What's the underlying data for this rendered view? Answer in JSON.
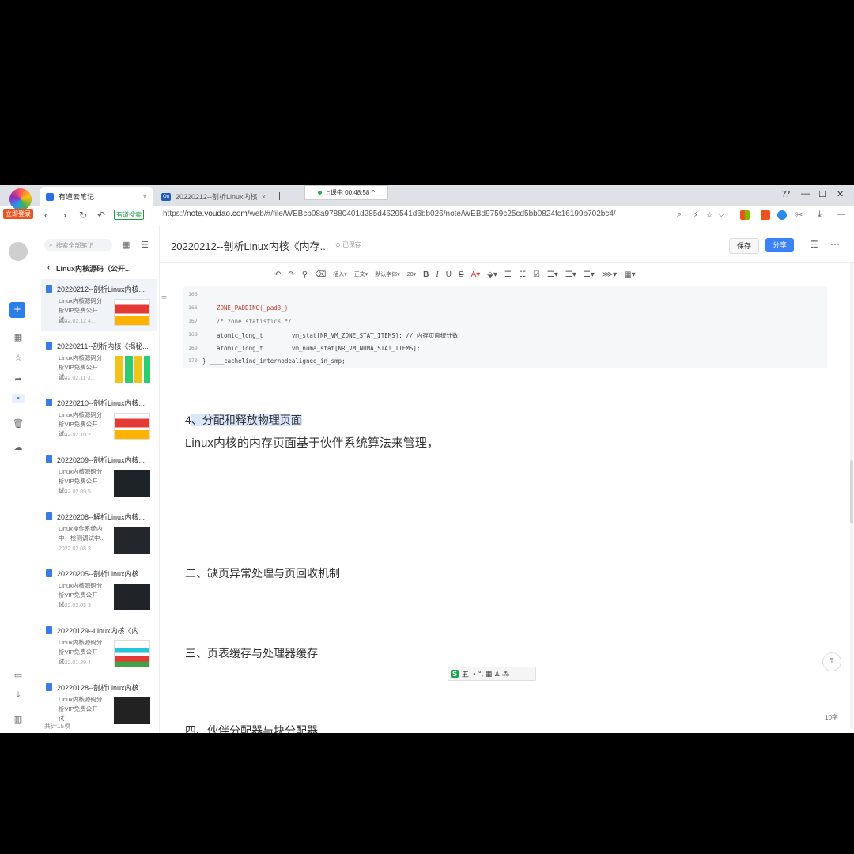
{
  "browser": {
    "logo_label": "立即登录",
    "tabs": [
      {
        "title": "有道云笔记",
        "active": true
      },
      {
        "title": "20220212--剖析Linux内核《",
        "active": false
      }
    ],
    "recording": "上课中 00:48:58",
    "window_controls": [
      "⁇",
      "—",
      "☐",
      "✕"
    ],
    "nav": {
      "back": "‹",
      "forward": "›",
      "reload": "↻",
      "home": "↶"
    },
    "secure_badge": "有道搜索",
    "url_scheme": "https://",
    "url_host": "note.youdao.com",
    "url_path": "/web/#/file/WEBcb08a97880401d285d4629541d6bb026/note/WEBd9759c25cd5bb0824fc16199b702bc4/"
  },
  "rail": {
    "new_button": "+",
    "items": [
      {
        "name": "recent",
        "glyph": "▦"
      },
      {
        "name": "star",
        "glyph": "☆"
      },
      {
        "name": "share",
        "glyph": "➦"
      },
      {
        "name": "folder",
        "glyph": "▪"
      },
      {
        "name": "trash",
        "glyph": "🗑"
      },
      {
        "name": "cloud",
        "glyph": "☁"
      },
      {
        "name": "device",
        "glyph": "▭"
      },
      {
        "name": "download",
        "glyph": "⤓"
      },
      {
        "name": "panel",
        "glyph": "▥"
      }
    ]
  },
  "panel": {
    "search_placeholder": "搜索全部笔记",
    "folder_back": "‹",
    "folder_name": "Linux内核源码（公开...",
    "notes": [
      {
        "title": "20220212--剖析Linux内核...",
        "summary": "Linux内核源码分\n析VIP免费公开试...",
        "date": "2022.02.12",
        "size": "4..."
      },
      {
        "title": "20220211--剖析内核《揭秘...",
        "summary": "Linux内核源码分\n析VIP免费公开试...",
        "date": "2022.02.11",
        "size": "3..."
      },
      {
        "title": "20220210--剖析Linux内核...",
        "summary": "Linux内核源码分\n析VIP免费公开试...",
        "date": "2022.02.10",
        "size": "2..."
      },
      {
        "title": "20220209--剖析Linux内核...",
        "summary": "Linux内核源码分\n析VIP免费公开试...",
        "date": "2022.02.09",
        "size": "5..."
      },
      {
        "title": "20220208--解析Linux内核...",
        "summary": "Linux操作系统内\n中，检测调试中...",
        "date": "2022.02.08",
        "size": "3..."
      },
      {
        "title": "20220205--剖析Linux内核...",
        "summary": "Linux内核源码分\n析VIP免费公开试...",
        "date": "2022.02.05",
        "size": "3"
      },
      {
        "title": "20220129--Linux内核《内...",
        "summary": "Linux内核源码分\n析VIP免费公开试...",
        "date": "2022.01.29",
        "size": "4"
      },
      {
        "title": "20220128--剖析Linux内核...",
        "summary": "Linux内核源码分\n析VIP免费公开试...",
        "date": "",
        "size": ""
      }
    ],
    "footer": "共计15项"
  },
  "editor": {
    "doc_title": "20220212--剖析Linux内核《内存...",
    "saved_status": "已保存",
    "save_label": "保存",
    "share_label": "分享",
    "toolbar": {
      "undo": "↶",
      "redo": "↷",
      "format_painter": "⚲",
      "eraser": "⌫",
      "insert": "插入▾",
      "paragraph": "正文▾",
      "font": "默认字体▾",
      "font_size": "28▾",
      "bold": "B",
      "italic": "I",
      "underline": "U",
      "strike": "S",
      "color": "A▾",
      "highlight": "⬙▾",
      "bullet": "☰",
      "numbered": "☷",
      "todo": "☑",
      "align": "☰▾",
      "indent": "☲▾",
      "line_height": "☰▾",
      "more": "⋙▾",
      "table": "▦▾"
    },
    "code_lines": [
      {
        "ln": "165",
        "text": ""
      },
      {
        "ln": "166",
        "text": "ZONE_PADDING(_pad3_)"
      },
      {
        "ln": "167",
        "text": "/* zone statistics */"
      },
      {
        "ln": "168",
        "text": "atomic_long_t        vm_stat[NR_VM_ZONE_STAT_ITEMS]; // 内存页面统计数"
      },
      {
        "ln": "169",
        "text": "atomic_long_t        vm_numa_stat[NR_VM_NUMA_STAT_ITEMS];"
      },
      {
        "ln": "170",
        "text": "} ____cacheline_internodealigned_in_smp;"
      }
    ],
    "heading_num": "4",
    "heading_text": "、分配和释放物理页面",
    "paragraph": "Linux内核的内存页面基于伙伴系统算法来管理，",
    "section2": "二、缺页异常处理与页回收机制",
    "section3": "三、页表缓存与处理器缓存",
    "section4": "四、伙伴分配器与块分配器",
    "ime_label": "五",
    "ime_icons": "◗ °, ▦ ♙ ⁂",
    "to_top": "⤒",
    "word_count": "10字"
  }
}
